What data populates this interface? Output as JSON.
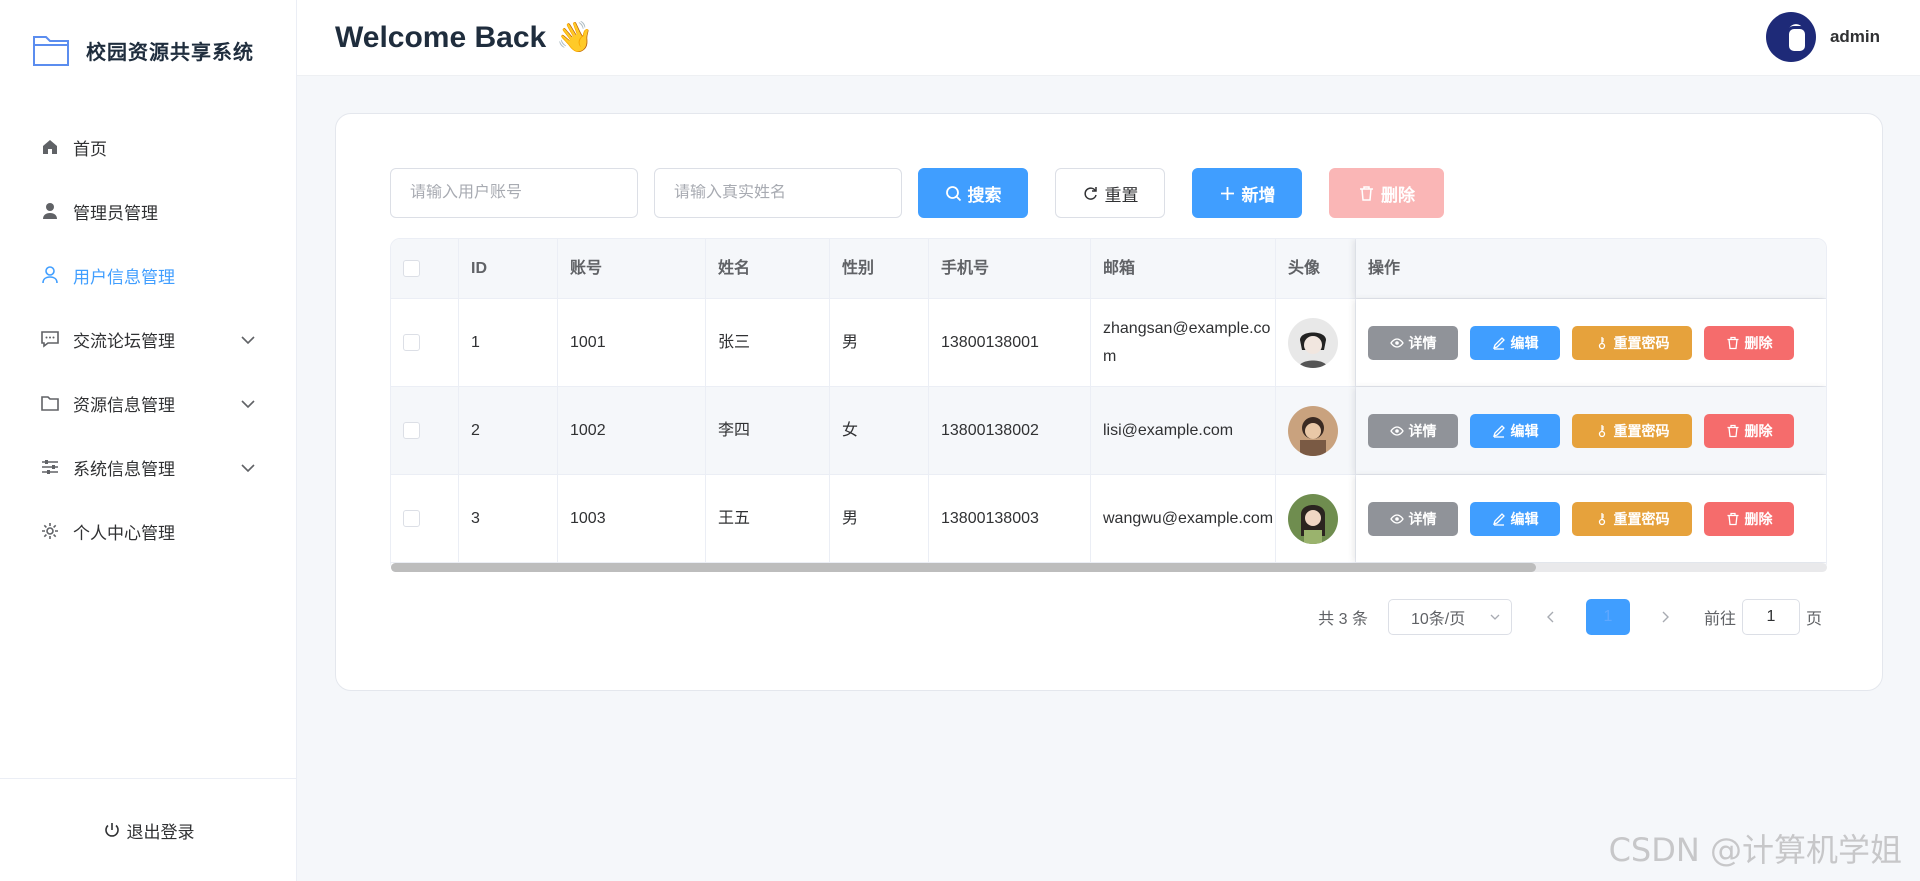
{
  "app": {
    "title": "校园资源共享系统"
  },
  "sidebar": {
    "items": [
      {
        "label": "首页",
        "icon": "home-icon",
        "active": false,
        "expandable": false
      },
      {
        "label": "管理员管理",
        "icon": "user-solid-icon",
        "active": false,
        "expandable": false
      },
      {
        "label": "用户信息管理",
        "icon": "user-icon",
        "active": true,
        "expandable": false
      },
      {
        "label": "交流论坛管理",
        "icon": "chat-icon",
        "active": false,
        "expandable": true
      },
      {
        "label": "资源信息管理",
        "icon": "folder-icon",
        "active": false,
        "expandable": true
      },
      {
        "label": "系统信息管理",
        "icon": "sliders-icon",
        "active": false,
        "expandable": true
      },
      {
        "label": "个人中心管理",
        "icon": "gear-icon",
        "active": false,
        "expandable": false
      }
    ],
    "logout_label": "退出登录"
  },
  "header": {
    "welcome": "Welcome Back",
    "wave": "👋",
    "username": "admin"
  },
  "search": {
    "account_placeholder": "请输入用户账号",
    "name_placeholder": "请输入真实姓名",
    "search_label": "搜索",
    "reset_label": "重置",
    "add_label": "新增",
    "delete_label": "删除"
  },
  "table": {
    "headers": [
      "ID",
      "账号",
      "姓名",
      "性别",
      "手机号",
      "邮箱",
      "头像",
      "操作"
    ],
    "rows": [
      {
        "id": "1",
        "account": "1001",
        "name": "张三",
        "sex": "男",
        "phone": "13800138001",
        "email": "zhangsan@example.com"
      },
      {
        "id": "2",
        "account": "1002",
        "name": "李四",
        "sex": "女",
        "phone": "13800138002",
        "email": "lisi@example.com"
      },
      {
        "id": "3",
        "account": "1003",
        "name": "王五",
        "sex": "男",
        "phone": "13800138003",
        "email": "wangwu@example.com"
      }
    ],
    "actions": {
      "detail": "详情",
      "edit": "编辑",
      "reset_pwd": "重置密码",
      "delete": "删除"
    }
  },
  "pagination": {
    "total": "共 3 条",
    "page_size": "10条/页",
    "current_page": "1",
    "goto_prefix": "前往",
    "goto_value": "1",
    "goto_suffix": "页"
  },
  "watermark": "CSDN @计算机学姐",
  "colors": {
    "primary": "#409eff",
    "warning": "#e6a23c",
    "danger": "#f56c6c",
    "info": "#909399"
  }
}
